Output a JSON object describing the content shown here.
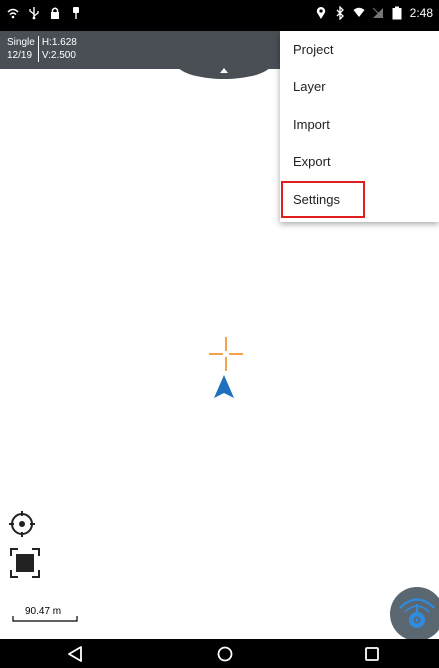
{
  "status_bar": {
    "time": "2:48",
    "icons_left": [
      "wifi-icon",
      "usb-icon",
      "lock-icon",
      "pin-icon"
    ],
    "icons_right": [
      "location-icon",
      "bluetooth-icon",
      "wifi-signal-icon",
      "no-sim-icon",
      "battery-icon"
    ]
  },
  "header": {
    "mode": "Single",
    "date": "12/19",
    "h_accuracy": "H:1.628",
    "v_accuracy": "V:2.500"
  },
  "menu": {
    "items": [
      {
        "label": "Project"
      },
      {
        "label": "Layer"
      },
      {
        "label": "Import"
      },
      {
        "label": "Export"
      },
      {
        "label": "Settings"
      }
    ],
    "highlighted": "Settings",
    "highlight_color": "#e02020"
  },
  "map": {
    "scale": "90.47 m",
    "crosshair_color": "#f08a24",
    "arrow_color": "#1f6fbf"
  },
  "nav": {
    "buttons": [
      "back-icon",
      "home-icon",
      "recents-icon"
    ]
  },
  "colors": {
    "header_bg": "#4a4f56",
    "status_bg": "#000000",
    "fab_bg": "#5b6770",
    "fab_accent": "#2e8be0"
  }
}
